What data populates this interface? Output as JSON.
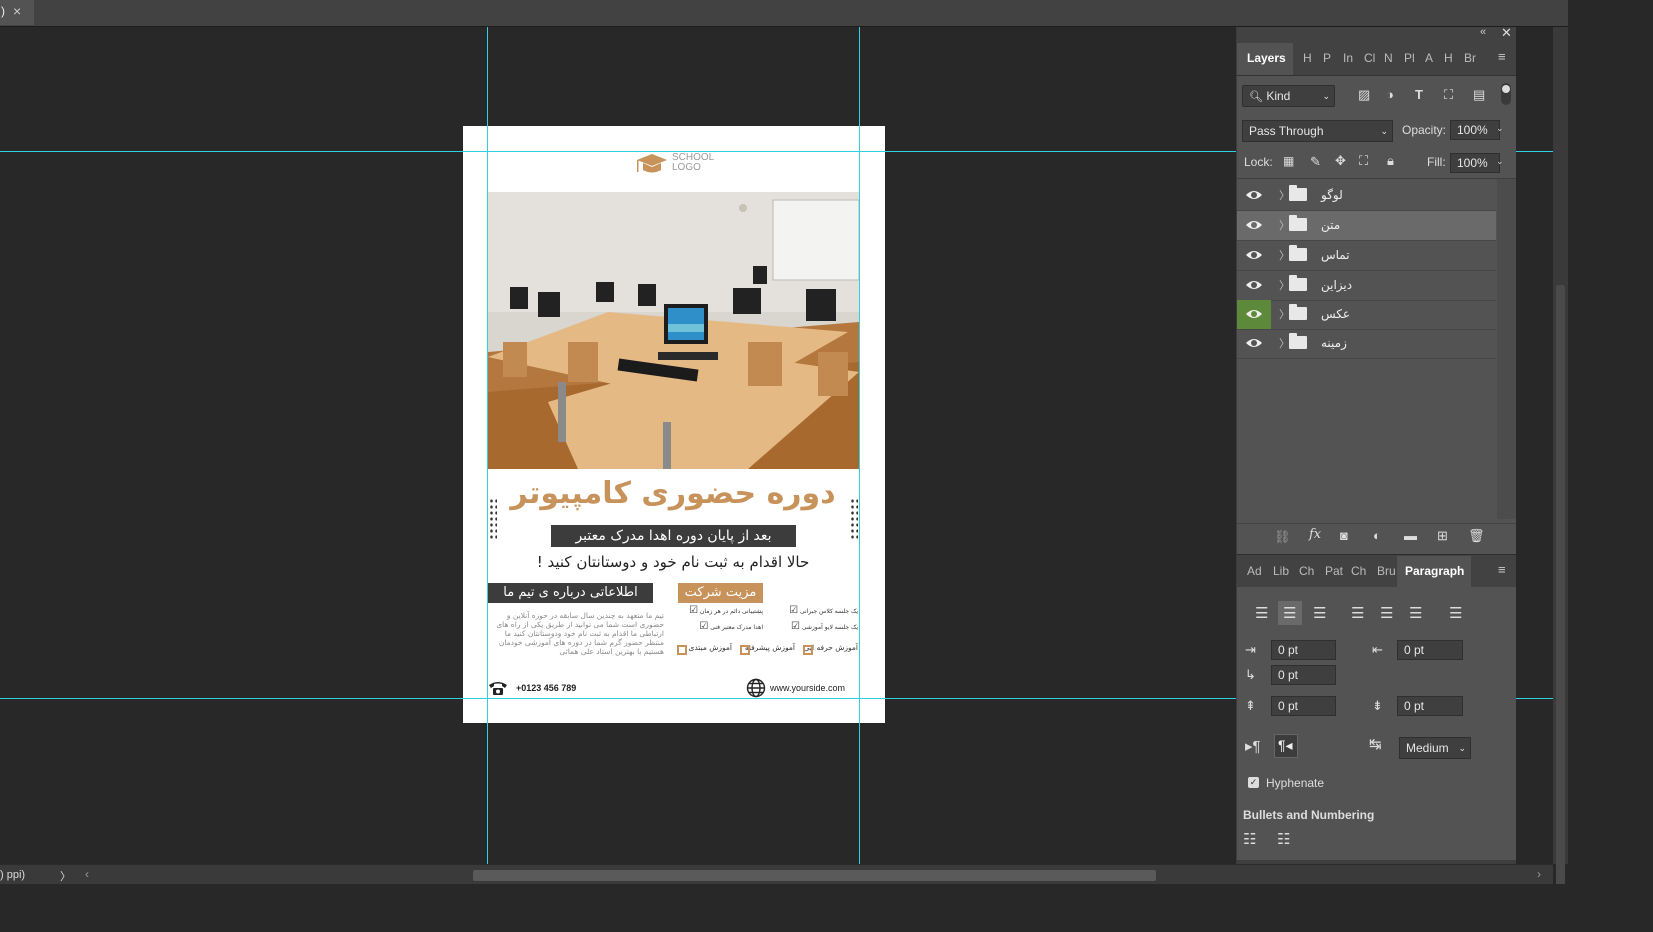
{
  "document_tab": {
    "title": ")",
    "close": "×"
  },
  "status": {
    "ppi": ") ppi)",
    "arrow": "〉",
    "scroll_left": "‹",
    "scroll_right": "›"
  },
  "poster": {
    "logo_line1": "SCHOOL",
    "logo_line2": "LOGO",
    "headline": "دوره حضوری کامپیوتر",
    "subheadline": "بعد از پایان دوره اهدا مدرک معتبر",
    "call_to_action": "حالا اقدام به ثبت نام خود و دوستانتان کنید !",
    "about_title": "اطلاعاتی درباره ی تیم ما",
    "about_text": "تیم ما متعهد به چندین سال سابقه در حوزه آنلاین و حضوری است شما می توانید از طریق یکی از راه های ارتباطی ما اقدام به ثبت نام خود ودوستانتان کنید ما منتظر حضور گرم شما در دوره های آموزشی خودمان هستیم با بهترین استاد علی همائی",
    "benefits_title": "مزیت شرکت",
    "benefits": [
      "یک جلسه کلاس جبرانی",
      "پشتیبانی دائم در هر زمان",
      "یک جلسه لایو آموزشی",
      "اهدا مدرک معتبر فنی"
    ],
    "levels": [
      "آموزش حرفه ایی",
      "آموزش پیشرفته",
      "آموزش مبتدی"
    ],
    "phone": "+0123 456 789",
    "website": "www.yourside.com"
  },
  "panel": {
    "tabs": [
      "Layers",
      "H",
      "P",
      "In",
      "Cl",
      "N",
      "Pl",
      "A",
      "H",
      "Br"
    ],
    "filter_kind": "Kind",
    "blend_mode": "Pass Through",
    "opacity_label": "Opacity:",
    "opacity_value": "100%",
    "lock_label": "Lock:",
    "fill_label": "Fill:",
    "fill_value": "100%",
    "layers": [
      {
        "name": "لوگو",
        "selected": false,
        "green": false
      },
      {
        "name": "متن",
        "selected": true,
        "green": false
      },
      {
        "name": "تماس",
        "selected": false,
        "green": false
      },
      {
        "name": "دیزاین",
        "selected": false,
        "green": false
      },
      {
        "name": "عکس",
        "selected": false,
        "green": true
      },
      {
        "name": "زمینه",
        "selected": false,
        "green": false
      }
    ],
    "fx_label": "fx"
  },
  "paragraph": {
    "tabs": [
      "Ad",
      "Lib",
      "Ch",
      "Pat",
      "Ch",
      "Bru",
      "Paragraph"
    ],
    "indent_left": "0 pt",
    "indent_right": "0 pt",
    "indent_first": "0 pt",
    "space_before": "0 pt",
    "space_after": "0 pt",
    "justification": "Medium",
    "hyphenate_label": "Hyphenate",
    "bullets_label": "Bullets and Numbering"
  },
  "colors": {
    "accent": "#c8935a",
    "guide": "#30d0e0",
    "panel": "#535353",
    "canvas": "#282828"
  }
}
